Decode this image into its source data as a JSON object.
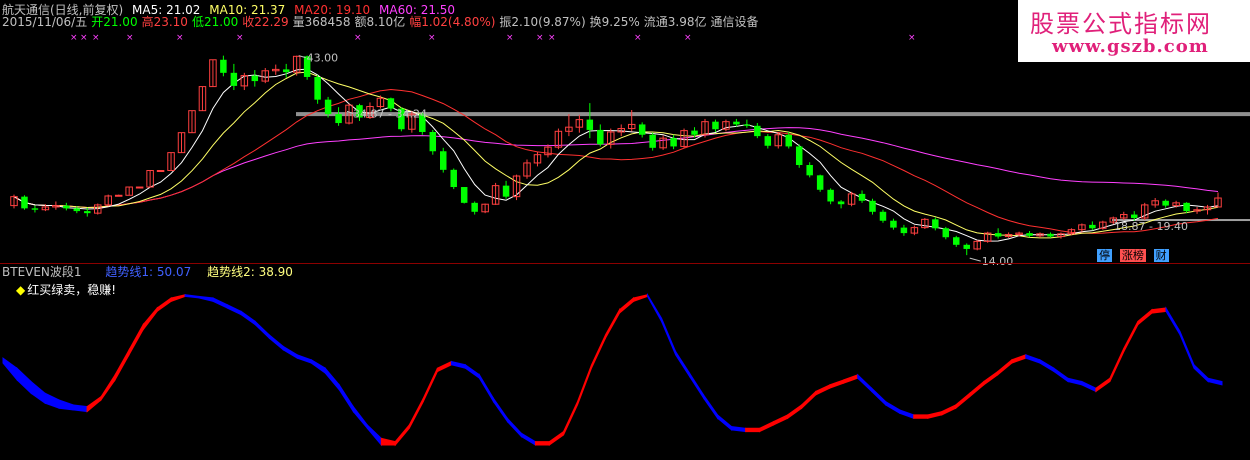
{
  "header": {
    "title": "航天通信(日线,前复权)",
    "items": [
      {
        "text": "MA5: 21.02",
        "color": "#ffffff"
      },
      {
        "text": "MA10: 21.37",
        "color": "#ffff66"
      },
      {
        "text": "MA20: 19.10",
        "color": "#ff3030"
      },
      {
        "text": "MA60: 21.50",
        "color": "#ff40ff"
      }
    ]
  },
  "quote": [
    {
      "text": "2015/11/06/五",
      "color": "#c0c0c0"
    },
    {
      "text": "开21.00",
      "color": "#00ff00"
    },
    {
      "text": "高23.10",
      "color": "#ff4040"
    },
    {
      "text": "低21.00",
      "color": "#00ff00"
    },
    {
      "text": "收22.29",
      "color": "#ff4040"
    },
    {
      "text": "量368458",
      "color": "#c0c0c0"
    },
    {
      "text": "额8.10亿",
      "color": "#c0c0c0"
    },
    {
      "text": "幅1.02(4.80%)",
      "color": "#ff4040"
    },
    {
      "text": "振2.10(9.87%)",
      "color": "#c0c0c0"
    },
    {
      "text": "换9.25%",
      "color": "#c0c0c0"
    },
    {
      "text": "流通3.98亿",
      "color": "#c0c0c0"
    },
    {
      "text": "通信设备",
      "color": "#c0c0c0"
    }
  ],
  "watermark": {
    "line1": "股票公式指标网",
    "line2": "www.gszb.com"
  },
  "tabs": [
    {
      "label": "停",
      "bg": "#40a0ff"
    },
    {
      "label": "涨榜",
      "bg": "#ff5050"
    },
    {
      "label": "财",
      "bg": "#40a0ff"
    }
  ],
  "indicator": {
    "name": "BTEVEN波段1",
    "line1_label": "趋势线1: 50.07",
    "line1_color": "#4060ff",
    "line2_label": "趋势线2: 38.90",
    "line2_color": "#ffff80",
    "note": "红买绿卖，稳赚!",
    "up_color": "#ff0000",
    "down_color": "#0000ff"
  },
  "chart_data": [
    {
      "type": "candlestick",
      "annotations": [
        "43.00",
        "34.87 - 34.24",
        "18.87 - 19.40",
        "14.00"
      ],
      "colors": {
        "up": "#ff4040",
        "down": "#00ff00",
        "ma5": "#ffffff",
        "ma10": "#ffff66",
        "ma20": "#ff3030",
        "ma60": "#ff40ff"
      },
      "ylim": [
        13,
        46
      ],
      "candles": [
        [
          21.2,
          22.8,
          20.8,
          22.5
        ],
        [
          22.5,
          22.7,
          20.6,
          20.8
        ],
        [
          20.8,
          21.2,
          20.2,
          20.6
        ],
        [
          20.6,
          21.4,
          20.4,
          21.0
        ],
        [
          21.0,
          21.8,
          20.6,
          21.2
        ],
        [
          21.2,
          21.6,
          20.5,
          20.8
        ],
        [
          20.8,
          21.1,
          20.1,
          20.4
        ],
        [
          20.4,
          20.9,
          19.6,
          20.1
        ],
        [
          20.1,
          21.5,
          19.9,
          21.3
        ],
        [
          21.3,
          22.8,
          21.1,
          22.6
        ],
        [
          22.6,
          22.8,
          22.6,
          22.7
        ],
        [
          22.7,
          23.9,
          22.7,
          23.9
        ],
        [
          23.9,
          23.9,
          23.9,
          23.9
        ],
        [
          23.9,
          26.3,
          23.9,
          26.3
        ],
        [
          26.3,
          26.3,
          26.3,
          26.3
        ],
        [
          26.3,
          28.9,
          26.3,
          28.9
        ],
        [
          28.9,
          31.8,
          28.9,
          31.8
        ],
        [
          31.8,
          35.0,
          31.8,
          35.0
        ],
        [
          35.0,
          38.5,
          35.0,
          38.5
        ],
        [
          38.5,
          42.4,
          38.5,
          42.4
        ],
        [
          42.4,
          43.0,
          40.0,
          40.5
        ],
        [
          40.5,
          41.8,
          38.0,
          38.6
        ],
        [
          38.6,
          40.5,
          38.0,
          40.1
        ],
        [
          40.1,
          40.9,
          38.5,
          39.3
        ],
        [
          39.3,
          41.2,
          39.0,
          40.8
        ],
        [
          40.8,
          41.7,
          40.2,
          41.0
        ],
        [
          41.0,
          41.8,
          39.8,
          40.6
        ],
        [
          40.6,
          43.0,
          40.1,
          42.9
        ],
        [
          42.9,
          43.0,
          39.5,
          39.9
        ],
        [
          39.9,
          40.2,
          36.0,
          36.6
        ],
        [
          36.6,
          37.0,
          34.0,
          34.5
        ],
        [
          34.5,
          35.5,
          32.8,
          33.2
        ],
        [
          33.2,
          36.0,
          33.0,
          35.8
        ],
        [
          35.8,
          36.0,
          33.5,
          34.0
        ],
        [
          34.0,
          36.2,
          33.8,
          35.6
        ],
        [
          35.6,
          37.2,
          35.3,
          36.8
        ],
        [
          36.8,
          36.9,
          34.9,
          35.3
        ],
        [
          35.3,
          35.5,
          32.0,
          32.3
        ],
        [
          32.3,
          34.9,
          31.8,
          34.5
        ],
        [
          34.5,
          34.8,
          31.5,
          31.9
        ],
        [
          31.9,
          32.2,
          28.6,
          29.1
        ],
        [
          29.1,
          29.6,
          26.0,
          26.4
        ],
        [
          26.4,
          26.6,
          23.6,
          23.9
        ],
        [
          23.9,
          23.9,
          21.5,
          21.6
        ],
        [
          21.6,
          21.8,
          19.9,
          20.3
        ],
        [
          20.3,
          21.5,
          20.1,
          21.4
        ],
        [
          21.4,
          24.5,
          21.3,
          24.1
        ],
        [
          24.1,
          24.8,
          22.2,
          22.5
        ],
        [
          22.5,
          25.7,
          22.0,
          25.5
        ],
        [
          25.5,
          27.9,
          25.1,
          27.4
        ],
        [
          27.4,
          29.0,
          26.9,
          28.6
        ],
        [
          28.6,
          30.1,
          28.2,
          29.7
        ],
        [
          29.7,
          32.4,
          29.4,
          32.0
        ],
        [
          32.0,
          34.5,
          31.3,
          32.6
        ],
        [
          32.6,
          34.4,
          31.8,
          33.7
        ],
        [
          33.7,
          36.1,
          31.0,
          32.2
        ],
        [
          32.2,
          33.0,
          29.8,
          30.1
        ],
        [
          30.1,
          32.4,
          29.5,
          31.9
        ],
        [
          31.9,
          33.0,
          31.3,
          32.4
        ],
        [
          32.4,
          35.1,
          32.0,
          33.0
        ],
        [
          33.0,
          33.3,
          31.1,
          31.5
        ],
        [
          31.5,
          31.8,
          29.2,
          29.6
        ],
        [
          29.6,
          31.4,
          29.3,
          31.0
        ],
        [
          31.0,
          31.5,
          29.4,
          29.8
        ],
        [
          29.8,
          32.4,
          29.6,
          32.1
        ],
        [
          32.1,
          32.6,
          31.1,
          31.5
        ],
        [
          31.5,
          33.8,
          31.1,
          33.4
        ],
        [
          33.4,
          33.7,
          31.9,
          32.3
        ],
        [
          32.3,
          33.7,
          32.0,
          33.4
        ],
        [
          33.4,
          33.8,
          32.7,
          33.0
        ],
        [
          33.0,
          33.7,
          32.5,
          32.8
        ],
        [
          32.8,
          33.2,
          31.0,
          31.3
        ],
        [
          31.3,
          31.6,
          29.5,
          29.9
        ],
        [
          29.9,
          31.9,
          29.5,
          31.5
        ],
        [
          31.5,
          31.9,
          29.5,
          29.8
        ],
        [
          29.8,
          30.1,
          26.7,
          27.1
        ],
        [
          27.1,
          27.5,
          25.3,
          25.6
        ],
        [
          25.6,
          25.7,
          23.2,
          23.5
        ],
        [
          23.5,
          23.7,
          21.4,
          21.8
        ],
        [
          21.8,
          22.0,
          20.8,
          21.4
        ],
        [
          21.4,
          23.2,
          21.1,
          22.9
        ],
        [
          22.9,
          23.4,
          21.6,
          21.9
        ],
        [
          21.9,
          22.2,
          19.9,
          20.3
        ],
        [
          20.3,
          20.6,
          18.7,
          19.0
        ],
        [
          19.0,
          19.3,
          17.7,
          18.0
        ],
        [
          18.0,
          18.4,
          16.8,
          17.2
        ],
        [
          17.2,
          18.3,
          16.9,
          18.0
        ],
        [
          18.0,
          19.4,
          17.8,
          19.2
        ],
        [
          19.2,
          19.5,
          17.6,
          17.9
        ],
        [
          17.9,
          18.1,
          16.3,
          16.6
        ],
        [
          16.6,
          16.8,
          15.2,
          15.5
        ],
        [
          15.5,
          15.7,
          14.0,
          14.9
        ],
        [
          14.9,
          16.2,
          14.7,
          16.0
        ],
        [
          16.0,
          17.4,
          15.8,
          17.2
        ],
        [
          17.2,
          17.9,
          16.4,
          16.7
        ],
        [
          16.7,
          17.3,
          16.5,
          17.0
        ],
        [
          17.0,
          17.4,
          16.7,
          17.2
        ],
        [
          17.2,
          17.5,
          16.6,
          16.8
        ],
        [
          16.8,
          17.3,
          16.5,
          17.1
        ],
        [
          17.1,
          17.3,
          16.5,
          16.7
        ],
        [
          16.7,
          17.3,
          16.4,
          17.1
        ],
        [
          17.1,
          17.9,
          16.9,
          17.7
        ],
        [
          17.7,
          18.6,
          17.4,
          18.4
        ],
        [
          18.4,
          18.9,
          17.6,
          17.9
        ],
        [
          17.9,
          19.0,
          17.7,
          18.8
        ],
        [
          18.8,
          19.6,
          18.5,
          19.4
        ],
        [
          19.4,
          20.3,
          19.1,
          19.9
        ],
        [
          19.9,
          20.4,
          19.0,
          19.4
        ],
        [
          19.4,
          21.6,
          19.1,
          21.3
        ],
        [
          21.3,
          22.3,
          20.9,
          21.9
        ],
        [
          21.9,
          22.1,
          20.9,
          21.2
        ],
        [
          21.2,
          21.9,
          20.9,
          21.6
        ],
        [
          21.6,
          21.7,
          20.1,
          20.4
        ],
        [
          20.4,
          21.0,
          20.0,
          20.6
        ],
        [
          20.6,
          21.3,
          19.9,
          21.0
        ],
        [
          21.0,
          23.1,
          21.0,
          22.3
        ]
      ]
    },
    {
      "type": "area",
      "series": [
        {
          "name": "趋势线1",
          "values": [
            55,
            45,
            37,
            31,
            28,
            27,
            26,
            33,
            45,
            60,
            75,
            86,
            92,
            95,
            94,
            92,
            88,
            84,
            78,
            70,
            63,
            58,
            55,
            49,
            39,
            26,
            16,
            6,
            6,
            16,
            32,
            50,
            54,
            52,
            46,
            32,
            20,
            11,
            6,
            6,
            12,
            30,
            52,
            70,
            85,
            92,
            95,
            80,
            60,
            47,
            34,
            22,
            15,
            14,
            14,
            18,
            22,
            28,
            36,
            40,
            43,
            46,
            38,
            30,
            25,
            22,
            22,
            24,
            28,
            35,
            42,
            48,
            55,
            58,
            55,
            50,
            44,
            42,
            38,
            44,
            62,
            78,
            85,
            86,
            72,
            52,
            44,
            42
          ]
        },
        {
          "name": "趋势线2",
          "values": [
            58,
            52,
            44,
            37,
            33,
            30,
            29,
            35,
            48,
            63,
            78,
            88,
            94,
            96,
            95,
            94,
            90,
            86,
            80,
            72,
            65,
            60,
            57,
            52,
            42,
            29,
            18,
            10,
            8,
            18,
            34,
            52,
            56,
            54,
            48,
            34,
            22,
            13,
            8,
            8,
            14,
            32,
            54,
            72,
            87,
            94,
            96,
            82,
            62,
            49,
            36,
            24,
            17,
            16,
            16,
            20,
            24,
            30,
            38,
            42,
            45,
            48,
            40,
            32,
            27,
            24,
            24,
            26,
            30,
            37,
            44,
            50,
            57,
            60,
            57,
            52,
            46,
            44,
            40,
            46,
            64,
            80,
            87,
            88,
            74,
            54,
            46,
            44
          ]
        }
      ]
    }
  ]
}
